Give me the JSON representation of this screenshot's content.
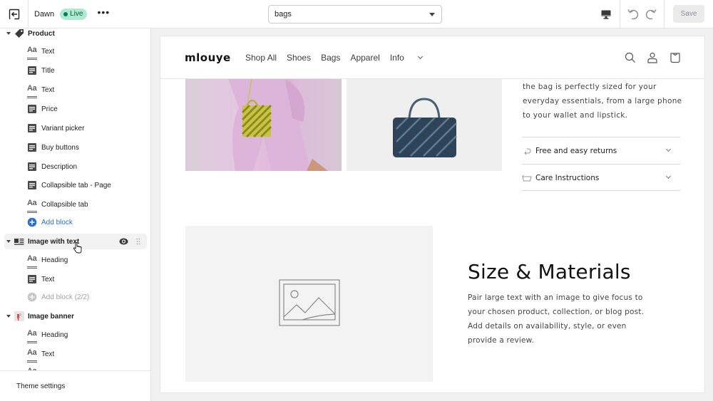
{
  "topbar": {
    "theme_name": "Dawn",
    "live_badge": "Live",
    "more_label": "•••",
    "page_select": {
      "value": "bags"
    },
    "save_label": "Save",
    "icons": {
      "exit": "exit-icon",
      "device": "desktop-icon",
      "undo": "undo-icon",
      "redo": "redo-icon"
    }
  },
  "sidebar": {
    "sections": [
      {
        "label": "Product",
        "icon": "tag-icon",
        "blocks": [
          {
            "label": "Text",
            "icon": "text-icon"
          },
          {
            "label": "Title",
            "icon": "block-icon"
          },
          {
            "label": "Text",
            "icon": "text-icon"
          },
          {
            "label": "Price",
            "icon": "block-icon"
          },
          {
            "label": "Variant picker",
            "icon": "block-icon"
          },
          {
            "label": "Buy buttons",
            "icon": "block-icon"
          },
          {
            "label": "Description",
            "icon": "block-icon"
          },
          {
            "label": "Collapsible tab - Page",
            "icon": "block-icon"
          },
          {
            "label": "Collapsible tab",
            "icon": "text-icon"
          }
        ],
        "add_label": "Add block"
      },
      {
        "label": "Image with text",
        "icon": "image-with-text-icon",
        "blocks": [
          {
            "label": "Heading",
            "icon": "text-icon"
          },
          {
            "label": "Text",
            "icon": "block-icon"
          }
        ],
        "add_label": "Add block (2/2)"
      },
      {
        "label": "Image banner",
        "icon": "image-thumbnail",
        "blocks": [
          {
            "label": "Heading",
            "icon": "text-icon"
          },
          {
            "label": "Text",
            "icon": "text-icon"
          }
        ]
      }
    ],
    "theme_settings_label": "Theme settings"
  },
  "preview": {
    "logo": "mlouye",
    "nav": [
      "Shop All",
      "Shoes",
      "Bags",
      "Apparel",
      "Info"
    ],
    "header_icons": [
      "search-icon",
      "account-icon",
      "cart-icon"
    ],
    "product_description": "the bag is perfectly sized for your everyday essentials, from a large phone to your wallet and lipstick.",
    "accordions": [
      {
        "label": "Free and easy returns",
        "icon": "return-icon"
      },
      {
        "label": "Care Instructions",
        "icon": "care-icon"
      }
    ],
    "image_with_text": {
      "heading": "Size & Materials",
      "body": "Pair large text with an image to give focus to your chosen product, collection, or blog post. Add details on availability, style, or even provide a review."
    }
  }
}
